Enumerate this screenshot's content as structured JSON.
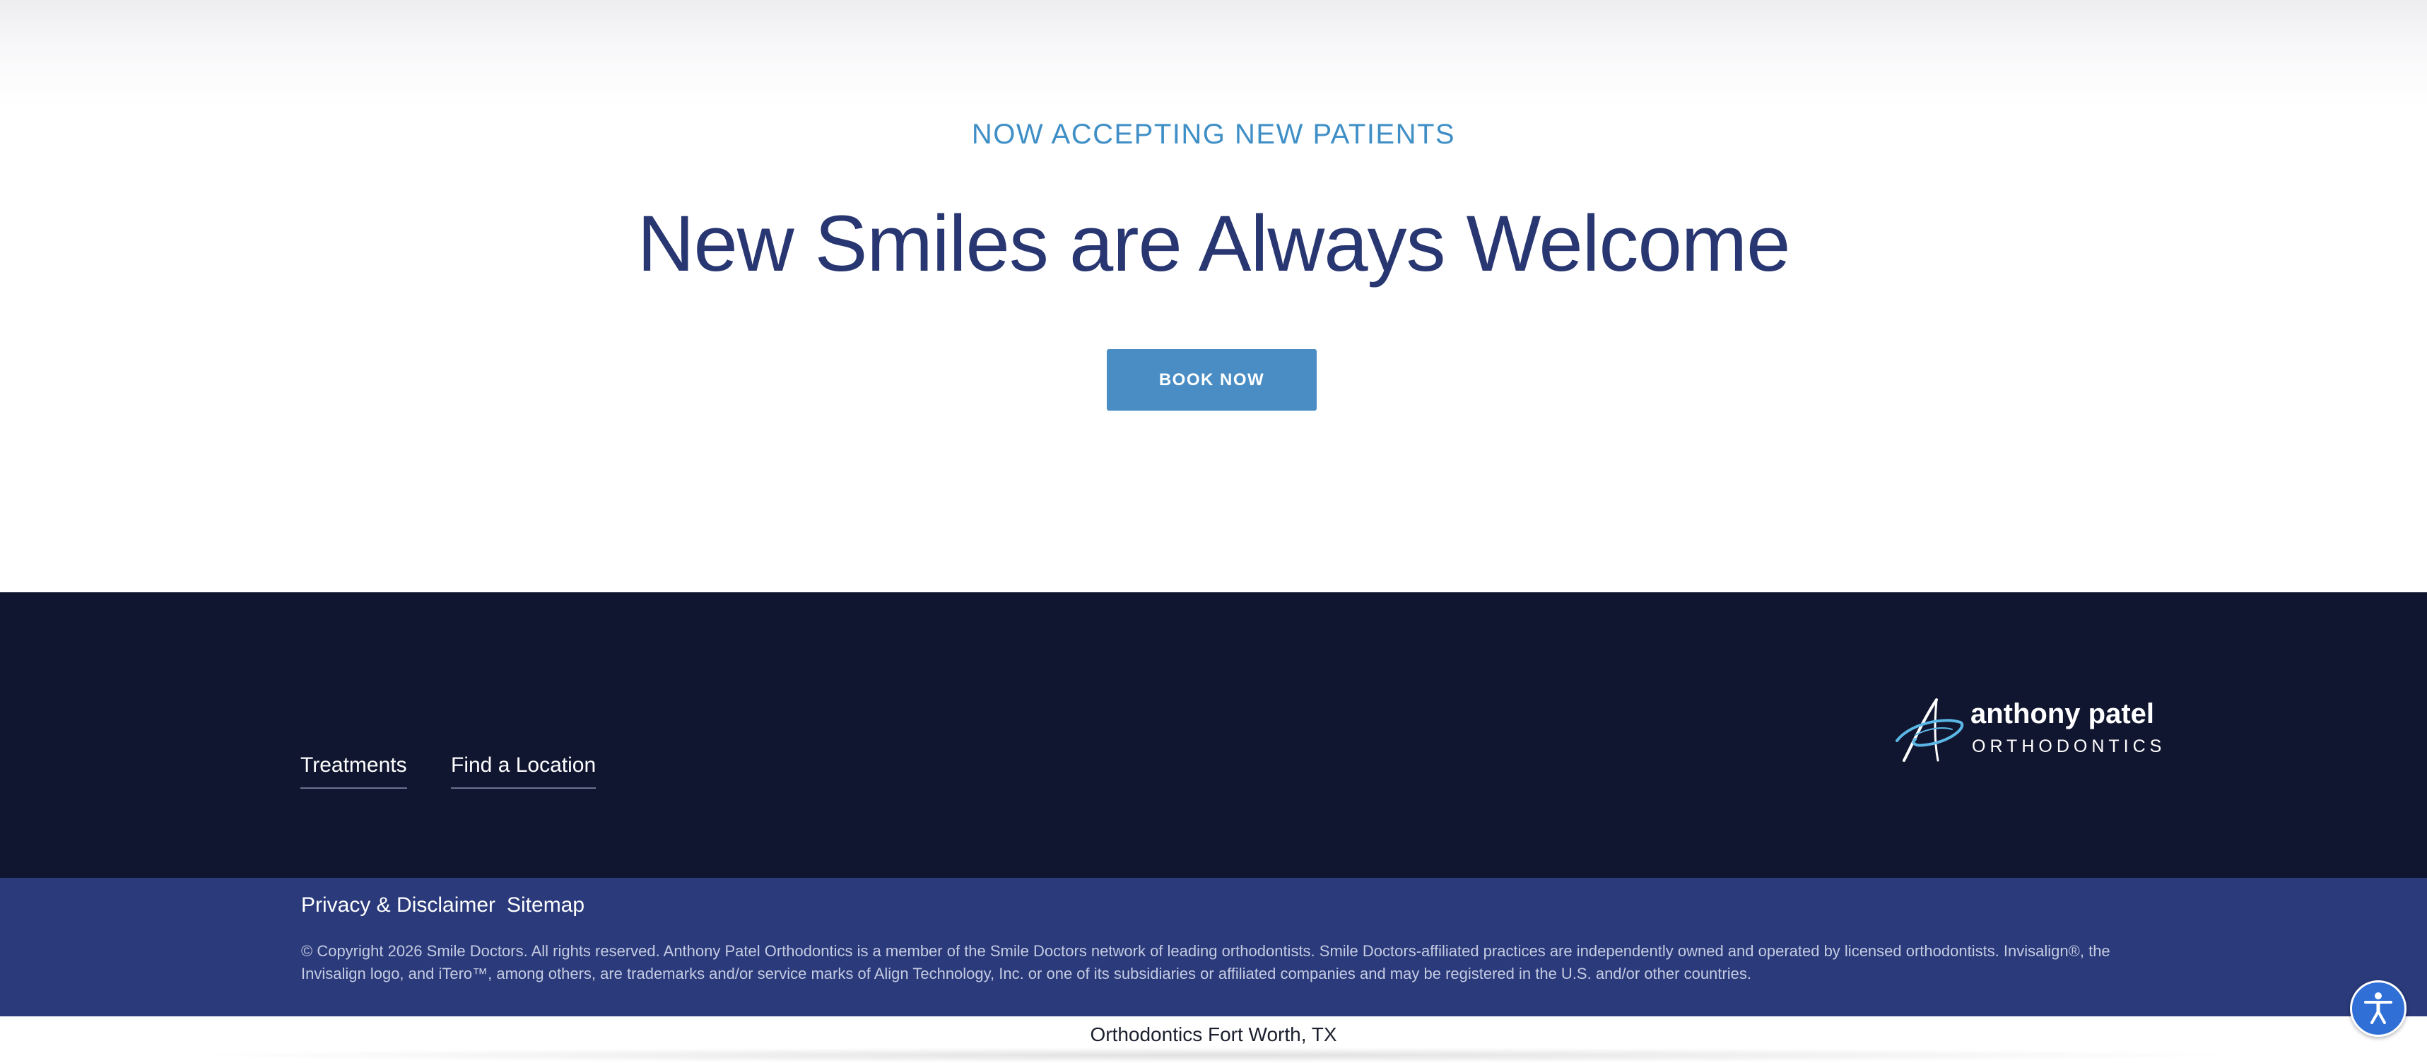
{
  "hero": {
    "eyebrow": "NOW ACCEPTING NEW PATIENTS",
    "title": "New Smiles are Always Welcome",
    "cta_label": "BOOK NOW"
  },
  "footer": {
    "nav": [
      {
        "label": "Treatments"
      },
      {
        "label": "Find a Location"
      }
    ],
    "logo": {
      "name": "anthony patel",
      "subtitle": "ORTHODONTICS",
      "icon": "ap-monogram-icon"
    },
    "legal_links": [
      {
        "label": "Privacy & Disclaimer"
      },
      {
        "label": "Sitemap"
      }
    ],
    "copyright": "© Copyright 2026 Smile Doctors. All rights reserved. Anthony Patel Orthodontics is a member of the Smile Doctors network of leading orthodontists. Smile Doctors-affiliated practices are independently owned and operated by licensed orthodontists. Invisalign®, the Invisalign logo, and iTero™, among others, are trademarks and/or service marks of Align Technology, Inc. or one of its subsidiaries or affiliated companies and may be registered in the U.S. and/or other countries."
  },
  "location_bar": {
    "text": "Orthodontics Fort Worth, TX"
  },
  "accessibility": {
    "icon": "accessibility-person-icon"
  },
  "colors": {
    "accent": "#4a8dc5",
    "heading": "#283671",
    "footer_dark": "#111630",
    "footer_bottom": "#2a3a7a",
    "a11y": "#2f6fd6"
  }
}
